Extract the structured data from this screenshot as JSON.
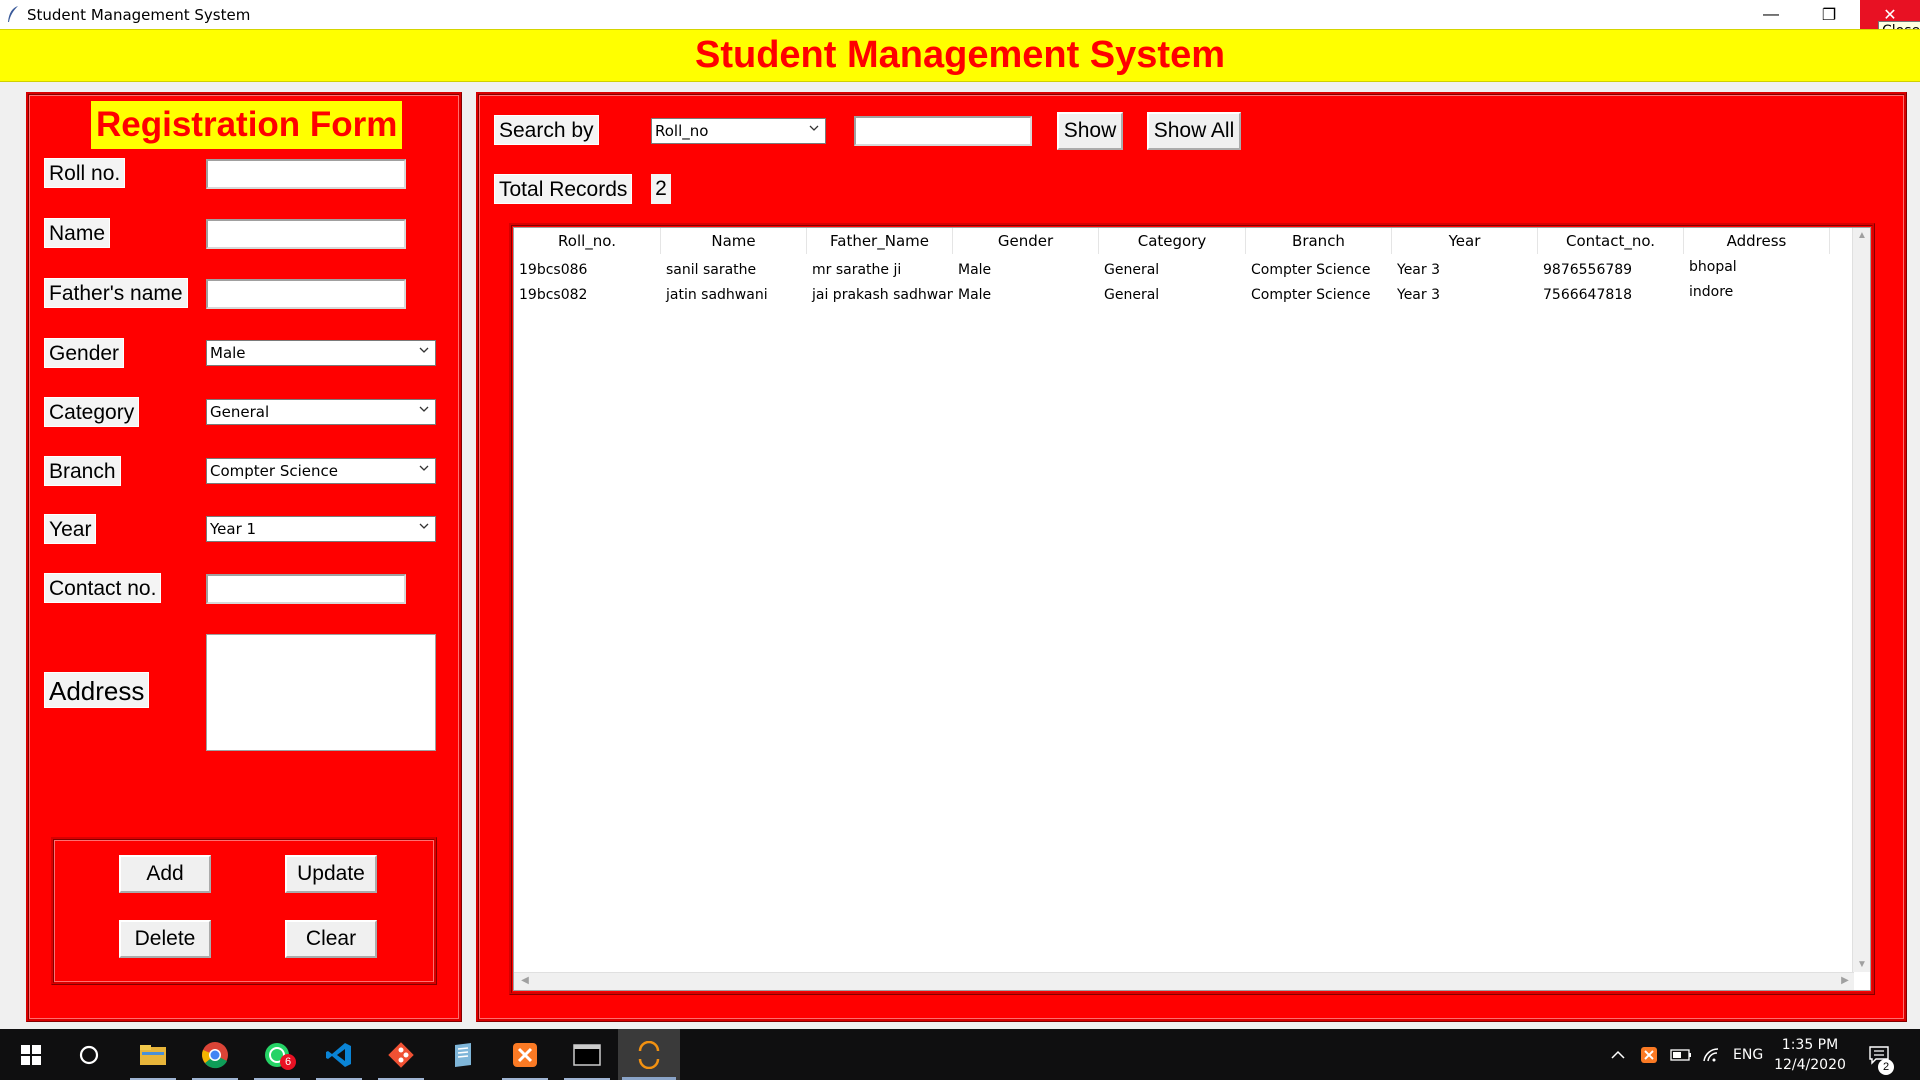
{
  "window": {
    "title": "Student Management System",
    "tooltip": "Close"
  },
  "header": {
    "title": "Student Management System"
  },
  "form": {
    "title": "Registration Form",
    "labels": {
      "roll_no": "Roll no.",
      "name": "Name",
      "father_name": "Father's name",
      "gender": "Gender",
      "category": "Category",
      "branch": "Branch",
      "year": "Year",
      "contact_no": "Contact no.",
      "address": "Address"
    },
    "values": {
      "roll_no": "",
      "name": "",
      "father_name": "",
      "gender": "Male",
      "category": "General",
      "branch": "Compter Science",
      "year": "Year 1",
      "contact_no": "",
      "address": ""
    },
    "buttons": {
      "add": "Add",
      "update": "Update",
      "delete": "Delete",
      "clear": "Clear"
    }
  },
  "search": {
    "label": "Search by",
    "field": "Roll_no",
    "text": "",
    "show_button": "Show",
    "show_all_button": "Show All",
    "total_label": "Total Records",
    "total_value": "2"
  },
  "table": {
    "columns": [
      "Roll_no.",
      "Name",
      "Father_Name",
      "Gender",
      "Category",
      "Branch",
      "Year",
      "Contact_no.",
      "Address"
    ],
    "rows": [
      [
        "19bcs086",
        "sanil sarathe",
        "mr sarathe ji",
        "Male",
        "General",
        "Compter Science",
        "Year 3",
        "9876556789",
        "bhopal"
      ],
      [
        "19bcs082",
        "jatin sadhwani",
        "jai prakash sadhwani",
        "Male",
        "General",
        "Compter Science",
        "Year 3",
        "7566647818",
        "indore"
      ]
    ]
  },
  "taskbar": {
    "clock_time": "1:35 PM",
    "clock_date": "12/4/2020",
    "language": "ENG",
    "whatsapp_badge": "6",
    "notification_badge": "2",
    "icons": [
      "windows-start-icon",
      "search-circle-icon",
      "file-explorer-icon",
      "chrome-icon",
      "whatsapp-icon",
      "vscode-icon",
      "git-icon",
      "notepad-icon",
      "xampp-icon",
      "terminal-icon",
      "python-idle-icon"
    ]
  }
}
